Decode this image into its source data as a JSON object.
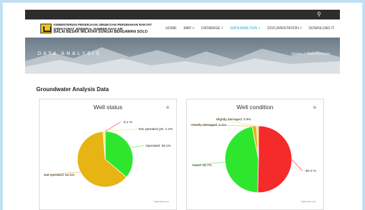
{
  "header": {
    "logo": {
      "line1": "KEMENTERIAN PEKERJAAN UMUM DAN PERUMAHAN RAKYAT",
      "line2": "DIREKTORAT JENDERAL SUMBER DAYA AIR",
      "line3": "BALAI BESAR WILAYAH SUNGAI BENGAWAN SOLO"
    },
    "search_icon": "⚲",
    "menu": [
      {
        "label": "HOME",
        "active": false
      },
      {
        "label": "MAP ˅",
        "active": false
      },
      {
        "label": "DATABASE ˅",
        "active": false
      },
      {
        "label": "DATA ANALYSIS ˅",
        "active": true
      },
      {
        "label": "DOCUMENTATION ˅",
        "active": false
      },
      {
        "label": "DOWNLOAD IT",
        "active": false
      }
    ]
  },
  "hero": {
    "title": "DATA ANALYSIS",
    "breadcrumb": {
      "home": "Home",
      "separator": "/",
      "current": "Data Analysis"
    }
  },
  "main": {
    "section_title": "Groundwater Analysis Data"
  },
  "chart_data": [
    {
      "type": "pie",
      "title": "Well status",
      "series": [
        {
          "name": "Operated",
          "label": "Operated: 36.1%",
          "value": 36.1,
          "color": "#2ee62e"
        },
        {
          "name": "Not operated",
          "label": "Not operated: 62.5%",
          "value": 62.5,
          "color": "#e6b514"
        },
        {
          "name": "Not operated yet",
          "label": "Not operated yet: 1.2%",
          "value": 1.2,
          "color": "#f5e65a"
        },
        {
          "name": "unlabeled",
          "label": ": 0.1 %",
          "value": 0.1,
          "color": "#ff2a2a"
        }
      ],
      "menu_icon": "≡",
      "credit": "Highcharts.com"
    },
    {
      "type": "pie",
      "title": "Well condition",
      "series": [
        {
          "name": "unlabeled",
          "label": ": 50.4 %",
          "value": 50.4,
          "color": "#f52a2a"
        },
        {
          "name": "Good",
          "label": "Good: 46.7%",
          "value": 46.7,
          "color": "#2ee62e"
        },
        {
          "name": "Heavily damaged",
          "label": "Heavily damaged: 2.1%",
          "value": 2.1,
          "color": "#e6b514"
        },
        {
          "name": "Slightly damaged",
          "label": "Slightly damaged: 0.9%",
          "value": 0.9,
          "color": "#f5e65a"
        }
      ],
      "menu_icon": "≡",
      "credit": "Highcharts.com"
    }
  ]
}
